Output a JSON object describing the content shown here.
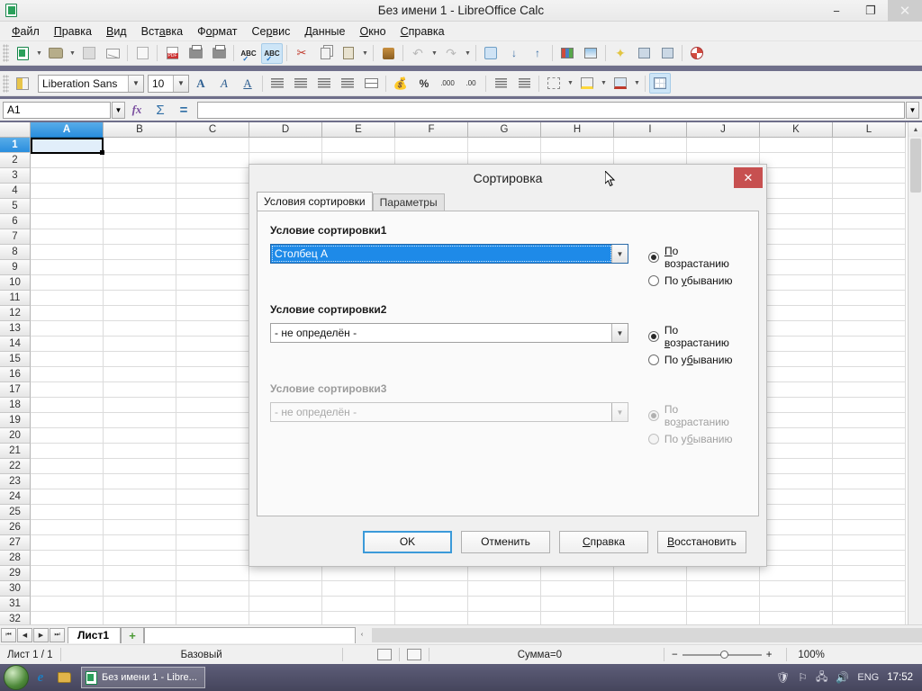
{
  "window": {
    "title": "Без имени 1 - LibreOffice Calc",
    "minimize": "−",
    "restore": "❐",
    "close": "✕"
  },
  "menu": {
    "items": [
      {
        "label": "Файл",
        "mnemonic": "Ф"
      },
      {
        "label": "Правка",
        "mnemonic": "П"
      },
      {
        "label": "Вид",
        "mnemonic": "В"
      },
      {
        "label": "Вставка",
        "mnemonic": "а"
      },
      {
        "label": "Формат",
        "mnemonic": "Ф"
      },
      {
        "label": "Сервис",
        "mnemonic": "р"
      },
      {
        "label": "Данные",
        "mnemonic": "Д"
      },
      {
        "label": "Окно",
        "mnemonic": "О"
      },
      {
        "label": "Справка",
        "mnemonic": "С"
      }
    ]
  },
  "toolbar_standard": {
    "icons": [
      "new-document-icon",
      "open-file-icon",
      "save-icon",
      "email-document-icon",
      "edit-mode-icon",
      "export-pdf-icon",
      "print-icon",
      "print-preview-icon",
      "spelling-check-icon",
      "autospellcheck-icon",
      "cut-icon",
      "copy-icon",
      "paste-icon",
      "clone-formatting-icon",
      "undo-icon",
      "redo-icon",
      "hyperlink-icon",
      "sort-ascending-icon",
      "sort-descending-icon",
      "chart-icon",
      "image-icon",
      "special-character-icon",
      "freeze-rows-icon",
      "split-window-icon",
      "help-icon"
    ]
  },
  "toolbar_formatting": {
    "font_name": "Liberation Sans",
    "font_size": "10",
    "icons": [
      "cell-styles-icon",
      "bold-icon",
      "italic-icon",
      "underline-icon",
      "align-left-icon",
      "align-center-icon",
      "align-right-icon",
      "justify-icon",
      "merge-cells-icon",
      "currency-format-icon",
      "percent-format-icon",
      "add-decimal-icon",
      "delete-decimal-icon",
      "decrease-indent-icon",
      "increase-indent-icon",
      "borders-icon",
      "background-color-icon",
      "font-color-icon",
      "grid-lines-icon"
    ]
  },
  "formula_bar": {
    "name_box": "A1",
    "function_wizard_icon": "fx",
    "sum_icon": "Σ",
    "formula_icon": "=",
    "input_value": ""
  },
  "sheet": {
    "columns": [
      "A",
      "B",
      "C",
      "D",
      "E",
      "F",
      "G",
      "H",
      "I",
      "J",
      "K",
      "L"
    ],
    "rows": [
      1,
      2,
      3,
      4,
      5,
      6,
      7,
      8,
      9,
      10,
      11,
      12,
      13,
      14,
      15,
      16,
      17,
      18,
      19,
      20,
      21,
      22,
      23,
      24,
      25,
      26,
      27,
      28,
      29,
      30,
      31,
      32
    ],
    "active_cell": "A1",
    "selected_column": "A",
    "selected_row": 1
  },
  "tabbar": {
    "first_label": "⏮",
    "prev_label": "◀",
    "next_label": "▶",
    "last_label": "⏭",
    "sheet_name": "Лист1",
    "add_sheet_label": "+",
    "hscroll_left": "‹"
  },
  "statusbar": {
    "sheet_count": "Лист 1 / 1",
    "page_style": "Базовый",
    "selection_mode_icon": "selection-mode-icon",
    "modified_icon": "document-modified-icon",
    "sum_info": "Сумма=0",
    "zoom_out": "−",
    "zoom_in": "+",
    "zoom_level": "100%"
  },
  "dialog": {
    "title": "Сортировка",
    "close_label": "✕",
    "tabs": [
      {
        "label": "Условия сортировки",
        "active": true
      },
      {
        "label": "Параметры",
        "active": false
      }
    ],
    "criteria": [
      {
        "label": "Условие сортировки1",
        "value": "Столбец A",
        "enabled": true,
        "selected": true,
        "ascending_label": "По возрастанию",
        "descending_label": "По убыванию",
        "ascending_checked": true
      },
      {
        "label": "Условие сортировки2",
        "value": "- не определён -",
        "enabled": true,
        "selected": false,
        "ascending_label": "По возрастанию",
        "descending_label": "По убыванию",
        "ascending_checked": true
      },
      {
        "label": "Условие сортировки3",
        "value": "- не определён -",
        "enabled": false,
        "selected": false,
        "ascending_label": "По возрастанию",
        "descending_label": "По убыванию",
        "ascending_checked": true
      }
    ],
    "buttons": [
      {
        "label": "OK",
        "focused": true
      },
      {
        "label": "Отменить",
        "focused": false
      },
      {
        "label": "Справка",
        "focused": false
      },
      {
        "label": "Восстановить",
        "focused": false
      }
    ]
  },
  "taskbar": {
    "start_icon": "start-orb-icon",
    "quick_launch": [
      "internet-explorer-icon",
      "file-explorer-icon"
    ],
    "task_label": "Без имени 1 - Libre...",
    "tray_icons": [
      "antivirus-icon",
      "flag-icon",
      "network-icon",
      "volume-icon"
    ],
    "language": "ENG",
    "clock": "17:52"
  },
  "colors": {
    "accent_blue": "#1e8ae8",
    "selection_header": "#2a8ede",
    "dialog_close_red": "#c75050",
    "focus_border": "#3b9ad9"
  }
}
